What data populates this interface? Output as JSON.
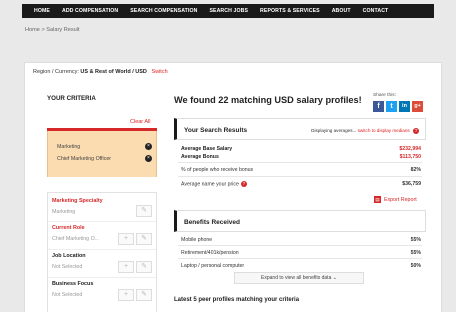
{
  "nav": [
    "HOME",
    "ADD COMPENSATION",
    "SEARCH COMPENSATION",
    "SEARCH JOBS",
    "REPORTS & SERVICES",
    "ABOUT",
    "CONTACT"
  ],
  "breadcrumb": "Home > Salary Result",
  "region": {
    "label": "Region / Currency:",
    "value": "US & Rest of World / USD",
    "switch": "Switch"
  },
  "criteria": {
    "title": "YOUR CRITERIA",
    "clear_all": "Clear All",
    "selected": [
      "Marketing",
      "Chief Marketing Officer"
    ],
    "remove_icon": "x-circle-icon",
    "filters": [
      {
        "label": "Marketing Specialty",
        "value": "Marketing"
      },
      {
        "label": "Current Role",
        "value": "Chief Marketing O..."
      },
      {
        "label": "Job Location",
        "value": "Not Selected"
      },
      {
        "label": "Business Focus",
        "value": "Not Selected"
      }
    ],
    "accent": "#d62828",
    "selected_bg": "#fbdcb0"
  },
  "headline": "We found 22 matching USD salary profiles!",
  "share": {
    "label": "Share this:",
    "buttons": [
      "f",
      "t",
      "in",
      "g+"
    ],
    "colors": [
      "#3b5998",
      "#1da1f2",
      "#0077b5",
      "#dd4b39"
    ]
  },
  "results": {
    "title": "Your Search Results",
    "note": "Displaying averages...",
    "note_link": "switch to display medians",
    "rows": [
      {
        "label": "Average Base Salary",
        "value": "$232,994",
        "bold": true,
        "red": true
      },
      {
        "label": "Average Bonus",
        "value": "$113,750",
        "bold": true,
        "red": true
      },
      {
        "label": "% of people who receive bonus",
        "value": "82%"
      },
      {
        "label": "Average name your price",
        "value": "$36,759"
      }
    ]
  },
  "export": "Export Report",
  "benefits": {
    "title": "Benefits Received",
    "rows": [
      {
        "label": "Mobile phone",
        "value": "55%"
      },
      {
        "label": "Retirement/401k/pension",
        "value": "55%"
      },
      {
        "label": "Laptop / personal computer",
        "value": "50%"
      }
    ],
    "expand": "Expand to view all benefits data"
  },
  "latest": "Latest 5 peer profiles matching your criteria"
}
